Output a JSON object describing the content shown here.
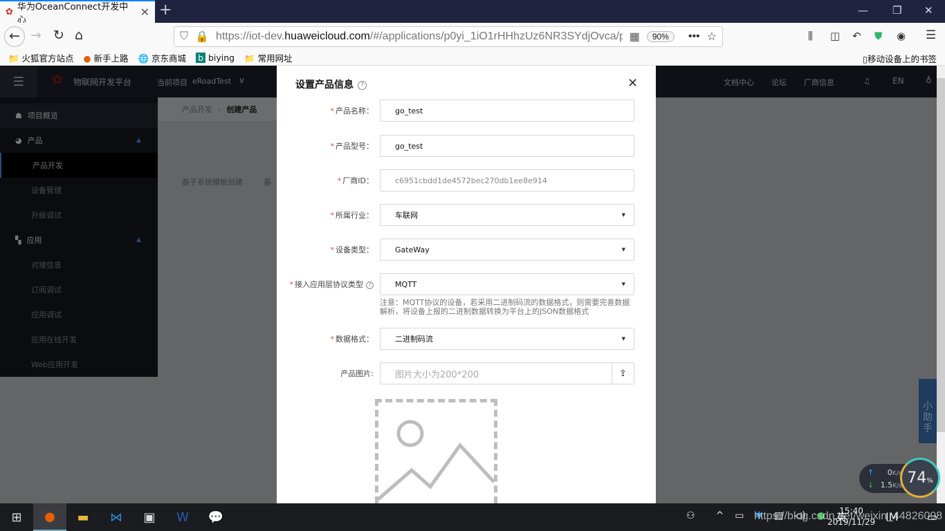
{
  "browser": {
    "tab_title": "华为OceanConnect开发中心",
    "url_prefix": "https://iot-dev.",
    "url_host": "huaweicloud.com",
    "url_path": "/#/applications/p0yi_1iO1rHHhzUz6NR3SYdjOvca/pr",
    "zoom": "90%",
    "bookmarks": [
      "火狐官方站点",
      "新手上路",
      "京东商城",
      "biying",
      "常用网址"
    ],
    "mobile_bookmarks": "移动设备上的书签"
  },
  "app": {
    "platform": "物联网开发平台",
    "brand": "HUAWEI",
    "project_label": "当前项目",
    "project": "eRoadTest",
    "nav": [
      "文档中心",
      "论坛",
      "厂商信息"
    ],
    "lang": "EN"
  },
  "sidebar": {
    "items": [
      {
        "label": "项目概览",
        "type": "top",
        "icon": "home-icon"
      },
      {
        "label": "产品",
        "type": "top",
        "icon": "product-icon"
      },
      {
        "label": "产品开发",
        "active": true
      },
      {
        "label": "设备管理"
      },
      {
        "label": "升级调试"
      },
      {
        "label": "应用",
        "type": "top",
        "icon": "grid-icon"
      },
      {
        "label": "对接信息"
      },
      {
        "label": "订阅调试"
      },
      {
        "label": "应用调试"
      },
      {
        "label": "应用在线开发"
      },
      {
        "label": "Web应用开发"
      }
    ]
  },
  "breadcrumb": {
    "parent": "产品开发",
    "current": "创建产品"
  },
  "content": {
    "tab": "基于系统模板创建",
    "tab2": "基"
  },
  "modal": {
    "title": "设置产品信息",
    "fields": [
      {
        "label": "产品名称：",
        "value": "go_test",
        "required": true
      },
      {
        "label": "产品型号：",
        "value": "go_test",
        "required": true
      },
      {
        "label": "厂商ID：",
        "value": "c6951cbdd1de4572bec270db1ee8e914",
        "required": true
      },
      {
        "label": "所属行业：",
        "value": "车联网",
        "required": true
      },
      {
        "label": "设备类型：",
        "value": "GateWay",
        "required": true
      },
      {
        "label": "接入应用层协议类型",
        "value": "MQTT",
        "required": true
      },
      {
        "label": "数据格式：",
        "value": "二进制码流",
        "required": true
      }
    ],
    "note": "注意：MQTT协议的设备，若采用二进制码流的数据格式，则需要完善数据解析，将设备上报的二进制数据转换为平台上的JSON数据格式",
    "image_label": "产品图片:",
    "image_placeholder": "图片大小为200*200"
  },
  "helper": "小助手",
  "netmon": {
    "up": "0",
    "down": "1.5",
    "unit": "K/s",
    "percent": "74",
    "percent_sign": "%"
  },
  "taskbar": {
    "time": "15:40",
    "date": "2019/11/29",
    "ime": "英",
    "watermark": "https://blog.csdn.net/weixin_44826098"
  }
}
